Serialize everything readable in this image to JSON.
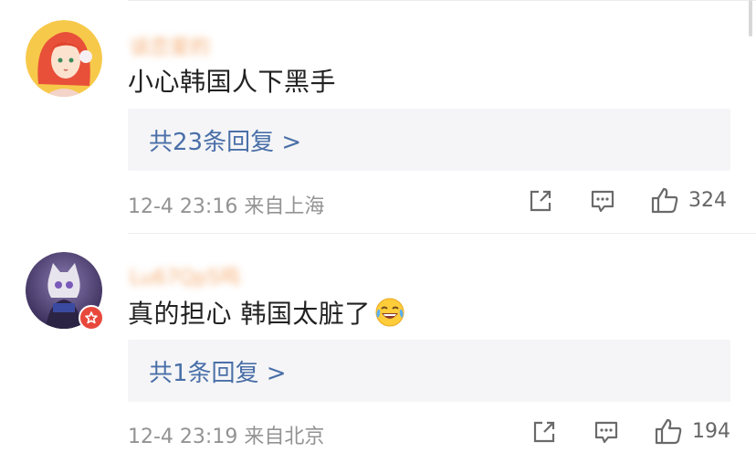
{
  "comments": [
    {
      "username": "谈恋爱的",
      "text": "小心韩国人下黑手",
      "emoji": "",
      "reply_link": "共23条回复 >",
      "meta": "12-4 23:16 来自上海",
      "likes": "324"
    },
    {
      "username": "Lu67Qp5鸣",
      "text": "真的担心 韩国太脏了",
      "emoji": "laughing-tears-emoji",
      "reply_link": "共1条回复 >",
      "meta": "12-4 23:19 来自北京",
      "likes": "194"
    }
  ],
  "colors": {
    "reply_link": "#4a6fa8",
    "meta": "#939393",
    "reply_bg": "#f5f5f7",
    "badge": "#e8483c"
  }
}
